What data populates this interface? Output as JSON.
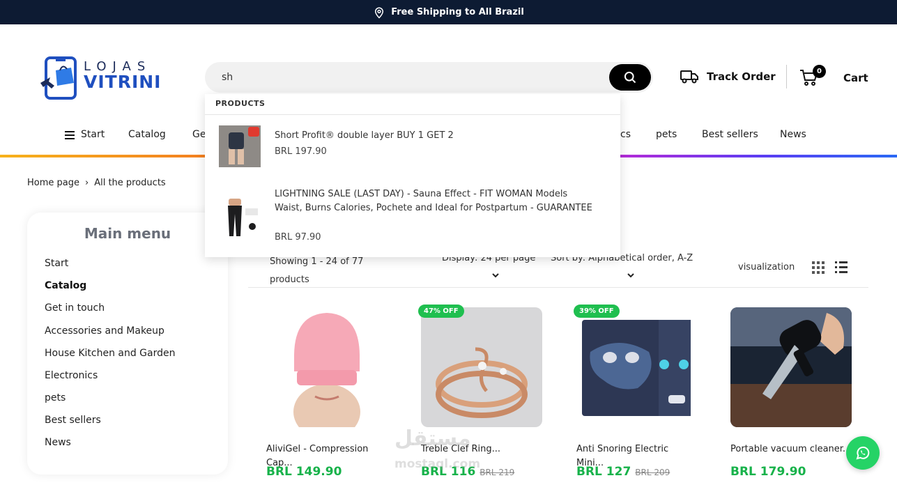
{
  "topbar": {
    "text": "Free Shipping to All Brazil",
    "icon": "location-pin-icon"
  },
  "logo": {
    "line1": "LOJAS",
    "line2": "VITRINI"
  },
  "search": {
    "value": "sh",
    "placeholder": ""
  },
  "header": {
    "track_label": "Track Order",
    "cart_label": "Cart",
    "cart_count": "0"
  },
  "nav": [
    "Start",
    "Catalog",
    "Ge",
    "cs",
    "pets",
    "Best sellers",
    "News"
  ],
  "breadcrumb": {
    "home": "Home page",
    "current": "All the products"
  },
  "sidebar": {
    "title": "Main menu",
    "items": [
      "Start",
      "Catalog",
      "Get in touch",
      "Accessories and Makeup",
      "House Kitchen and Garden",
      "Electronics",
      "pets",
      "Best sellers",
      "News"
    ],
    "active": "Catalog"
  },
  "toolbar": {
    "count": "Showing 1 - 24 of 77 products",
    "display": "Display: 24 per page",
    "sort": "Sort by: Alphabetical order, A-Z",
    "visualization": "visualization"
  },
  "dropdown": {
    "heading": "PRODUCTS",
    "items": [
      {
        "title": "Short Profit® double layer BUY 1 GET 2",
        "price": "BRL 197.90"
      },
      {
        "title": "LIGHTNING SALE (LAST DAY) - Sauna Effect - FIT WOMAN Models Waist, Burns Calories, Pochete and Ideal for Postpartum - GUARANTEE",
        "price": "BRL 97.90"
      }
    ]
  },
  "products": [
    {
      "name": "AliviGel - Compression Cap...",
      "badge": "",
      "price": "BRL 149.90",
      "old_price": ""
    },
    {
      "name": "Treble Clef Ring...",
      "badge": "47% OFF",
      "price": "BRL 116",
      "old_price": "BRL 219"
    },
    {
      "name": "Anti Snoring Electric Mini...",
      "badge": "39% OFF",
      "price": "BRL 127",
      "old_price": "BRL 209"
    },
    {
      "name": "Portable vacuum cleaner...",
      "badge": "",
      "price": "BRL 179.90",
      "old_price": ""
    }
  ],
  "watermark": {
    "line1": "مستقل",
    "line2": "mostaql.com"
  },
  "colors": {
    "topbar": "#0d1b33",
    "accent_green": "#17b24a",
    "badge_green": "#1fbf4f",
    "whatsapp": "#25d366"
  }
}
